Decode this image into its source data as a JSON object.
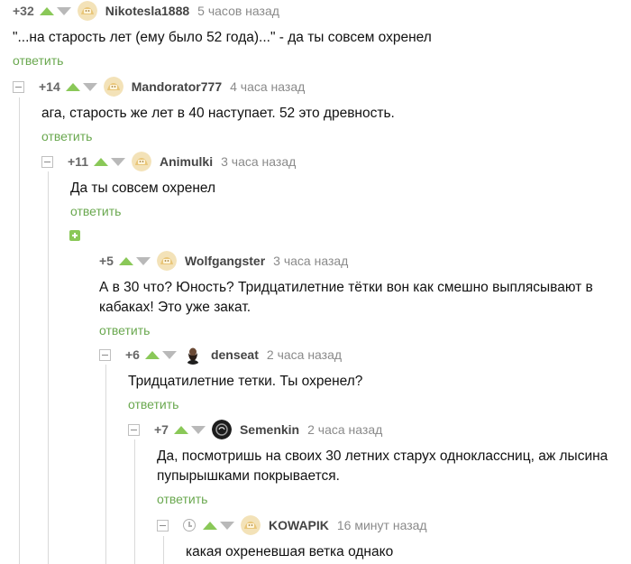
{
  "comments": [
    {
      "rating": "+32",
      "author": "Nikotesla1888",
      "time": "5 часов назад",
      "text": "\"...на старость лет  (ему было 52 года)...\" - да ты совсем охренел",
      "reply": "ответить",
      "avatar": "default-avatar"
    },
    {
      "rating": "+14",
      "author": "Mandorator777",
      "time": "4 часа назад",
      "text": "ага, старость же лет в 40 наступает. 52 это древность.",
      "reply": "ответить",
      "avatar": "default-avatar"
    },
    {
      "rating": "+11",
      "author": "Animulki",
      "time": "3 часа назад",
      "text": "Да ты совсем охренел",
      "reply": "ответить",
      "avatar": "default-avatar"
    },
    {
      "rating": "+5",
      "author": "Wolfgangster",
      "time": "3 часа назад",
      "text_lines": [
        "А в 30 что? Юность? Тридцатилетние тётки вон как смешно выплясывают в",
        "кабаках! Это уже закат."
      ],
      "reply": "ответить",
      "avatar": "default-avatar"
    },
    {
      "rating": "+6",
      "author": "denseat",
      "time": "2 часа назад",
      "text": "Тридцатилетние тетки. Ты охренел?",
      "reply": "ответить",
      "avatar": "bearded-man-avatar"
    },
    {
      "rating": "+7",
      "author": "Semenkin",
      "time": "2 часа назад",
      "text_lines": [
        "Да, посмотришь на своих 30 летних старух одноклассниц, аж лысина",
        "пупырышками покрывается."
      ],
      "reply": "ответить",
      "avatar": "dark-circle-avatar"
    },
    {
      "rating": "",
      "author": "KOWAPIK",
      "time": "16 минут назад",
      "text": "какая охреневшая ветка однако",
      "avatar": "default-avatar"
    }
  ],
  "colors": {
    "upvote": "#8ac858",
    "downvote": "#b9b9b9",
    "reply_link": "#6aa84f",
    "author": "#444444",
    "time": "#8a8a8a"
  }
}
